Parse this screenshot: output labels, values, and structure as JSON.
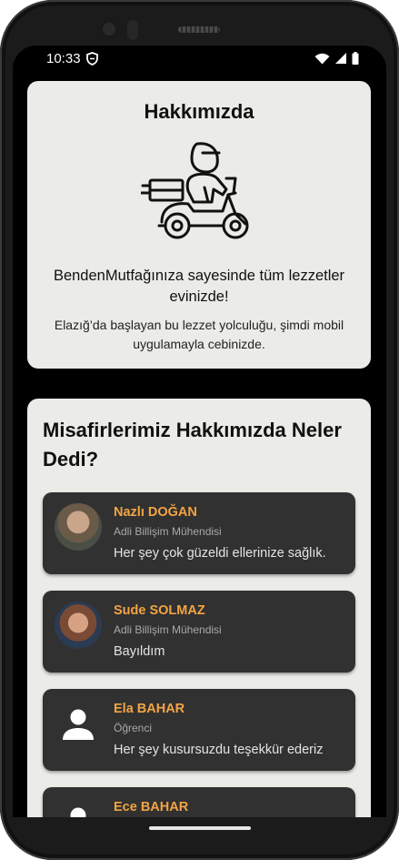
{
  "status_bar": {
    "time": "10:33",
    "icons": [
      "shield-icon",
      "wifi-icon",
      "signal-icon",
      "battery-icon"
    ]
  },
  "about": {
    "title": "Hakkımızda",
    "illustration": "delivery-scooter-icon",
    "slogan": "BendenMutfağınıza sayesinde tüm lezzetler evinizde!",
    "description": "Elazığ’da başlayan bu lezzet yolculuğu, şimdi mobil uygulamayla cebinizde."
  },
  "reviews": {
    "title": "Misafirlerimiz Hakkımızda Neler Dedi?",
    "items": [
      {
        "name": "Nazlı DOĞAN",
        "role": "Adli Billişim Mühendisi",
        "comment": "Her şey çok güzeldi ellerinize sağlık.",
        "avatar": "photo"
      },
      {
        "name": "Sude SOLMAZ",
        "role": "Adli Billişim Mühendisi",
        "comment": "Bayıldım",
        "avatar": "photo"
      },
      {
        "name": "Ela BAHAR",
        "role": "Öğrenci",
        "comment": "Her şey kusursuzdu teşekkür ederiz",
        "avatar": "person-icon"
      },
      {
        "name": "Ece BAHAR",
        "role": "",
        "comment": "",
        "avatar": "person-icon"
      }
    ]
  },
  "colors": {
    "card_bg": "#ebebe7",
    "review_bg": "#313131",
    "name_accent": "#f3a443",
    "screen_bg": "#000000"
  }
}
